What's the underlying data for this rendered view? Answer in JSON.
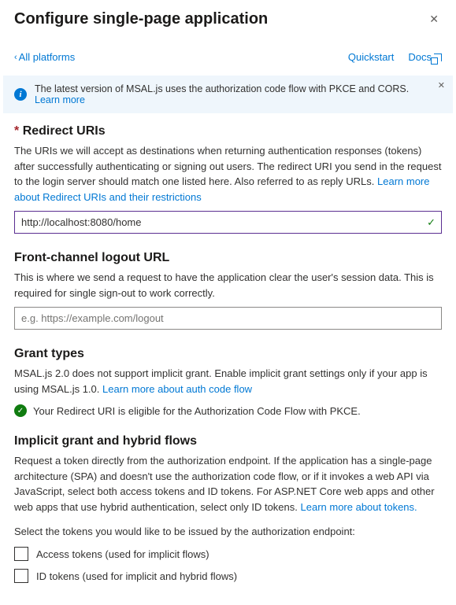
{
  "header": {
    "title": "Configure single-page application"
  },
  "topbar": {
    "back": "All platforms",
    "quickstart": "Quickstart",
    "docs": "Docs"
  },
  "banner": {
    "text": "The latest version of MSAL.js uses the authorization code flow with PKCE and CORS.",
    "link": "Learn more"
  },
  "redirect": {
    "title": "Redirect URIs",
    "desc": "The URIs we will accept as destinations when returning authentication responses (tokens) after successfully authenticating or signing out users. The redirect URI you send in the request to the login server should match one listed here. Also referred to as reply URLs. ",
    "link": "Learn more about Redirect URIs and their restrictions",
    "value": "http://localhost:8080/home"
  },
  "logout": {
    "title": "Front-channel logout URL",
    "desc": "This is where we send a request to have the application clear the user's session data. This is required for single sign-out to work correctly.",
    "placeholder": "e.g. https://example.com/logout"
  },
  "grant": {
    "title": "Grant types",
    "desc": "MSAL.js 2.0 does not support implicit grant. Enable implicit grant settings only if your app is using MSAL.js 1.0. ",
    "link": "Learn more about auth code flow",
    "eligible": "Your Redirect URI is eligible for the Authorization Code Flow with PKCE."
  },
  "implicit": {
    "title": "Implicit grant and hybrid flows",
    "desc": "Request a token directly from the authorization endpoint. If the application has a single-page architecture (SPA) and doesn't use the authorization code flow, or if it invokes a web API via JavaScript, select both access tokens and ID tokens. For ASP.NET Core web apps and other web apps that use hybrid authentication, select only ID tokens. ",
    "link": "Learn more about tokens.",
    "select_prompt": "Select the tokens you would like to be issued by the authorization endpoint:",
    "access_label": "Access tokens (used for implicit flows)",
    "id_label": "ID tokens (used for implicit and hybrid flows)"
  }
}
